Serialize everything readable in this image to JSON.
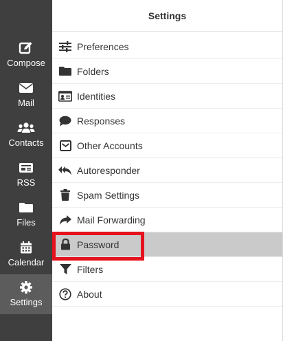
{
  "sidebar": {
    "items": [
      {
        "label": "Compose",
        "icon": "compose-icon"
      },
      {
        "label": "Mail",
        "icon": "mail-icon"
      },
      {
        "label": "Contacts",
        "icon": "contacts-icon"
      },
      {
        "label": "RSS",
        "icon": "rss-icon"
      },
      {
        "label": "Files",
        "icon": "folder-icon"
      },
      {
        "label": "Calendar",
        "icon": "calendar-icon"
      },
      {
        "label": "Settings",
        "icon": "gear-icon",
        "active": true
      }
    ]
  },
  "settings": {
    "title": "Settings",
    "items": [
      {
        "label": "Preferences",
        "icon": "sliders-icon"
      },
      {
        "label": "Folders",
        "icon": "folder-icon"
      },
      {
        "label": "Identities",
        "icon": "id-card-icon"
      },
      {
        "label": "Responses",
        "icon": "speech-bubble-icon"
      },
      {
        "label": "Other Accounts",
        "icon": "envelope-square-icon"
      },
      {
        "label": "Autoresponder",
        "icon": "reply-all-icon"
      },
      {
        "label": "Spam Settings",
        "icon": "trash-icon"
      },
      {
        "label": "Mail Forwarding",
        "icon": "forward-arrow-icon"
      },
      {
        "label": "Password",
        "icon": "lock-icon",
        "selected": true
      },
      {
        "label": "Filters",
        "icon": "funnel-icon"
      },
      {
        "label": "About",
        "icon": "question-circle-icon"
      }
    ]
  },
  "colors": {
    "sidebar_bg": "#3f3f3f",
    "sidebar_active": "#5c5c5c",
    "selected_row": "#cacaca",
    "highlight": "#e5121e"
  }
}
